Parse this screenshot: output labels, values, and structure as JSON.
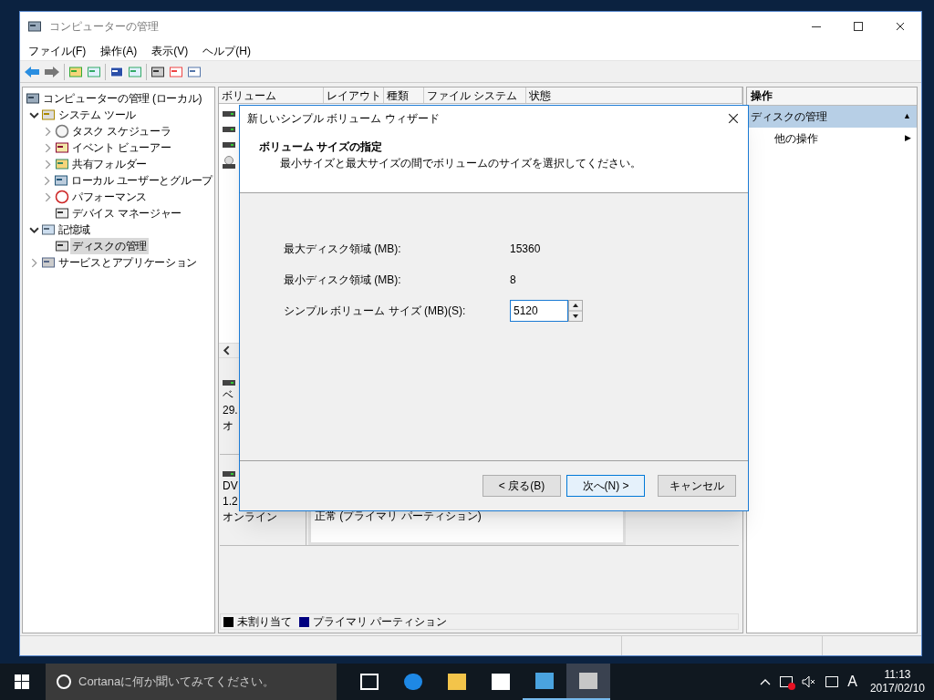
{
  "window": {
    "title": "コンピューターの管理"
  },
  "menu": [
    "ファイル(F)",
    "操作(A)",
    "表示(V)",
    "ヘルプ(H)"
  ],
  "tree": [
    {
      "label": "コンピューターの管理 (ローカル)",
      "expandable": false,
      "selected": false,
      "children": [
        {
          "label": "システム ツール",
          "expandable": true,
          "expanded": true,
          "selected": false,
          "children": [
            {
              "label": "タスク スケジューラ",
              "expandable": true,
              "expanded": false,
              "selected": false
            },
            {
              "label": "イベント ビューアー",
              "expandable": true,
              "expanded": false,
              "selected": false
            },
            {
              "label": "共有フォルダー",
              "expandable": true,
              "expanded": false,
              "selected": false
            },
            {
              "label": "ローカル ユーザーとグループ",
              "expandable": true,
              "expanded": false,
              "selected": false
            },
            {
              "label": "パフォーマンス",
              "expandable": true,
              "expanded": false,
              "selected": false
            },
            {
              "label": "デバイス マネージャー",
              "expandable": false,
              "selected": false
            }
          ]
        },
        {
          "label": "記憶域",
          "expandable": true,
          "expanded": true,
          "selected": false,
          "children": [
            {
              "label": "ディスクの管理",
              "expandable": false,
              "selected": true
            }
          ]
        },
        {
          "label": "サービスとアプリケーション",
          "expandable": true,
          "expanded": false,
          "selected": false
        }
      ]
    }
  ],
  "volume_table": {
    "columns": [
      "ボリューム",
      "レイアウト",
      "種類",
      "ファイル システム",
      "状態"
    ]
  },
  "disks": [
    {
      "lines": [
        "ベ",
        "29.",
        "オ"
      ]
    },
    {
      "lines": [
        "DV",
        "1.2",
        "オンライン"
      ],
      "partition": "正常 (プライマリ パーティション)"
    }
  ],
  "legend": [
    {
      "label": "未割り当て",
      "color": "#000000"
    },
    {
      "label": "プライマリ パーティション",
      "color": "#000080"
    }
  ],
  "actions": {
    "title": "操作",
    "items": [
      {
        "label": "ディスクの管理",
        "selected": true,
        "arrow": "▲"
      },
      {
        "label": "他の操作",
        "selected": false,
        "arrow": "▶"
      }
    ]
  },
  "dialog": {
    "title": "新しいシンプル ボリューム ウィザード",
    "heading": "ボリューム サイズの指定",
    "subtitle": "最小サイズと最大サイズの間でボリュームのサイズを選択してください。",
    "fields": [
      {
        "kind": "text",
        "label": "最大ディスク領域 (MB):",
        "value": "15360"
      },
      {
        "kind": "text",
        "label": "最小ディスク領域 (MB):",
        "value": "8"
      },
      {
        "kind": "spin",
        "label": "シンプル ボリューム サイズ (MB)(S):",
        "value": "5120"
      }
    ],
    "buttons": [
      {
        "label": "< 戻る(B)",
        "selected": false
      },
      {
        "label": "次へ(N) >",
        "selected": true
      },
      {
        "label": "キャンセル",
        "selected": false
      }
    ]
  },
  "taskbar": {
    "search_placeholder": "Cortanaに何か聞いてみてください。",
    "ime": "A",
    "time": "11:13",
    "date": "2017/02/10"
  }
}
